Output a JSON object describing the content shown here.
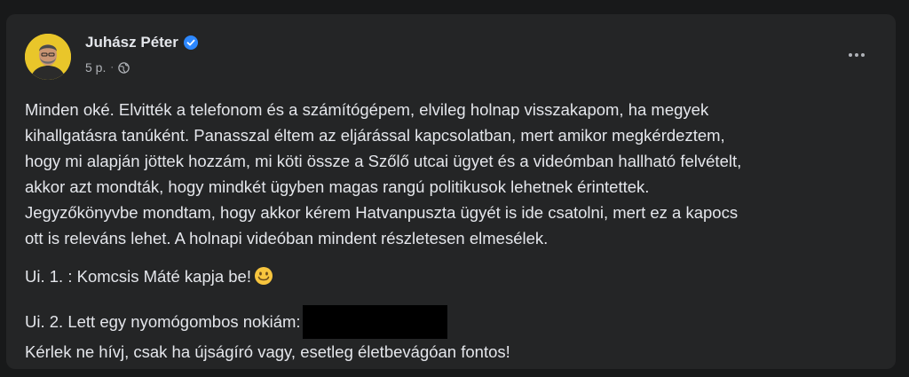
{
  "post": {
    "author": "Juhász Péter",
    "time": "5 p.",
    "separator": "·",
    "body_lines": [
      "Minden oké. Elvitték a telefonom és a számítógépem, elvileg holnap visszakapom, ha megyek",
      "kihallgatásra tanúként. Panasszal éltem az eljárással kapcsolatban, mert amikor megkérdeztem,",
      "hogy mi alapján jöttek hozzám, mi köti össze a Szőlő utcai ügyet és a videómban hallható felvételt,",
      "akkor azt mondták, hogy mindkét ügyben magas rangú politikusok lehetnek érintettek.",
      "Jegyzőkönyvbe mondtam, hogy akkor kérem Hatvanpuszta ügyét is ide csatolni, mert ez a kapocs",
      "ott is releváns lehet. A holnapi videóban mindent részletesen elmesélek."
    ],
    "ps1": "Ui. 1. : Komcsis Máté kapja be!",
    "ps2_line1": "Ui. 2. Lett egy nyomógombos nokiám:",
    "ps2_line2": "Kérlek ne hívj, csak ha újságíró vagy, esetleg életbevágóan fontos!"
  },
  "icons": {
    "verified": "verified-badge-icon",
    "privacy": "globe-icon",
    "more": "more-options-icon",
    "emoji": "smiley-emoji-icon"
  },
  "colors": {
    "background": "#18191a",
    "card": "#242526",
    "text": "#e4e6eb",
    "secondary_text": "#b0b3b8",
    "verified_blue": "#2d88ff",
    "avatar_bg": "#e9c62a"
  }
}
